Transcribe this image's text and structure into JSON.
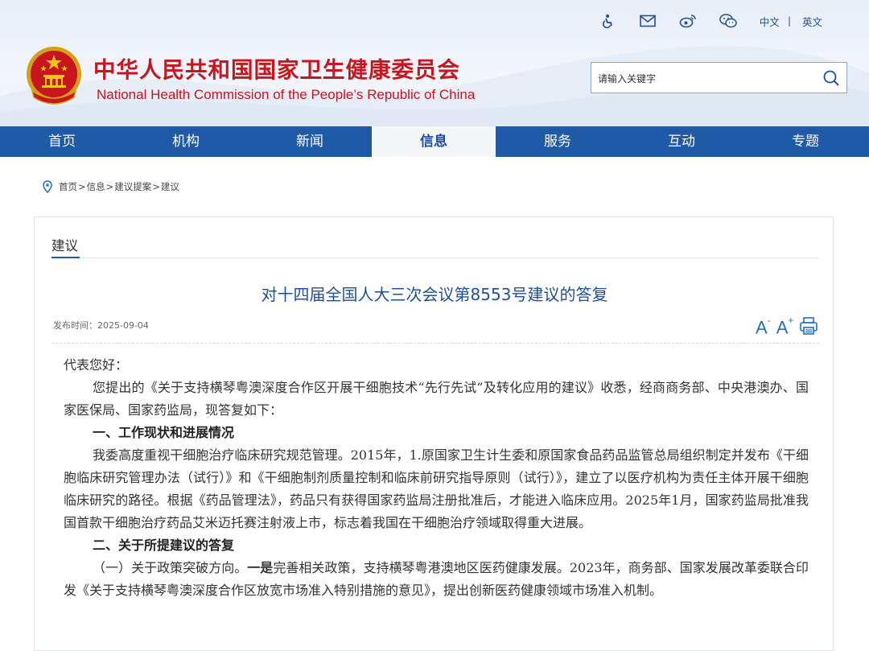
{
  "header": {
    "org_name_cn": "中华人民共和国国家卫生健康委员会",
    "org_name_en": "National Health Commission of the People’s  Republic of China",
    "lang_cn": "中文",
    "lang_sep": "|",
    "lang_en": "英文",
    "icons": [
      "accessibility-icon",
      "mail-icon",
      "weibo-icon",
      "wechat-icon"
    ],
    "search_placeholder": "请输入关键字"
  },
  "nav": {
    "items": [
      {
        "label": "首页"
      },
      {
        "label": "机构"
      },
      {
        "label": "新闻"
      },
      {
        "label": "信息",
        "active": true
      },
      {
        "label": "服务"
      },
      {
        "label": "互动"
      },
      {
        "label": "专题"
      }
    ]
  },
  "breadcrumb": {
    "items": [
      "首页",
      "信息",
      "建议提案",
      "建议"
    ],
    "separator": ">"
  },
  "section": {
    "title": "建议"
  },
  "document": {
    "title": "对十四届全国人大三次会议第8553号建议的答复",
    "date_label": "发布时间：",
    "date": "2025-09-04",
    "font_decrease_label": "A",
    "font_decrease_sup": "-",
    "font_increase_label": "A",
    "font_increase_sup": "+",
    "paragraphs": {
      "greeting": "代表您好：",
      "p1": "您提出的《关于支持横琴粤澳深度合作区开展干细胞技术“先行先试”及转化应用的建议》收悉，经商商务部、中央港澳办、国家医保局、国家药监局，现答复如下：",
      "h1": "一、工作现状和进展情况",
      "p2": "我委高度重视干细胞治疗临床研究规范管理。2015年，1.原国家卫生计生委和原国家食品药品监管总局组织制定并发布《干细胞临床研究管理办法（试行）》和《干细胞制剂质量控制和临床前研究指导原则（试行）》，建立了以医疗机构为责任主体开展干细胞临床研究的路径。根据《药品管理法》，药品只有获得国家药监局注册批准后，才能进入临床应用。2025年1月，国家药监局批准我国首款干细胞治疗药品艾米迈托赛注射液上市，标志着我国在干细胞治疗领域取得重大进展。",
      "h2": "二、关于所提建议的答复",
      "p3_lead": "（一）关于政策突破方向。",
      "p3_bold": "一是",
      "p3_rest": "完善相关政策，支持横琴粤港澳地区医药健康发展。2023年，商务部、国家发展改革委联合印发《关于支持横琴粤澳深度合作区放宽市场准入特别措施的意见》，提出创新医药健康领域市场准入机制。"
    }
  },
  "colors": {
    "brand_red": "#c7161e",
    "nav_blue": "#1f5aa6",
    "title_blue": "#1f4f9a"
  }
}
